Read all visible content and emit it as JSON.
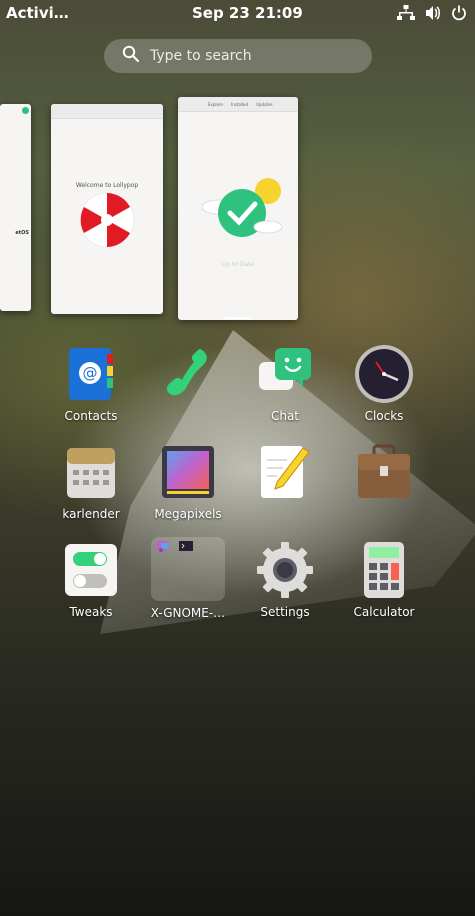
{
  "panel": {
    "activities": "Activi…",
    "clock": "Sep 23  21:09",
    "tray_icons": [
      "network-icon",
      "volume-icon",
      "power-icon"
    ]
  },
  "search": {
    "placeholder": "Type to search"
  },
  "windows": [
    {
      "name": "partial-window",
      "text": "etOS",
      "subtext": ""
    },
    {
      "name": "lollypop-window",
      "title": "Welcome to Lollypop"
    },
    {
      "name": "software-window",
      "tabs": [
        "Explore",
        "Installed",
        "Updates"
      ],
      "caption": "Up to Date"
    }
  ],
  "apps": [
    {
      "label": "Contacts",
      "icon": "contacts-icon"
    },
    {
      "label": "",
      "icon": "phone-icon"
    },
    {
      "label": "Chat",
      "icon": "chat-icon"
    },
    {
      "label": "Clocks",
      "icon": "clock-icon"
    },
    {
      "label": "karlender",
      "icon": "calendar-icon"
    },
    {
      "label": "Megapixels",
      "icon": "camera-icon"
    },
    {
      "label": "",
      "icon": "text-editor-icon"
    },
    {
      "label": "",
      "icon": "briefcase-icon"
    },
    {
      "label": "Tweaks",
      "icon": "tweaks-icon"
    },
    {
      "label": "X-GNOME-…",
      "icon": "folder-icon"
    },
    {
      "label": "Settings",
      "icon": "settings-icon"
    },
    {
      "label": "Calculator",
      "icon": "calculator-icon"
    }
  ],
  "colors": {
    "accent": "#3584e4",
    "panel_text": "#ffffff"
  }
}
